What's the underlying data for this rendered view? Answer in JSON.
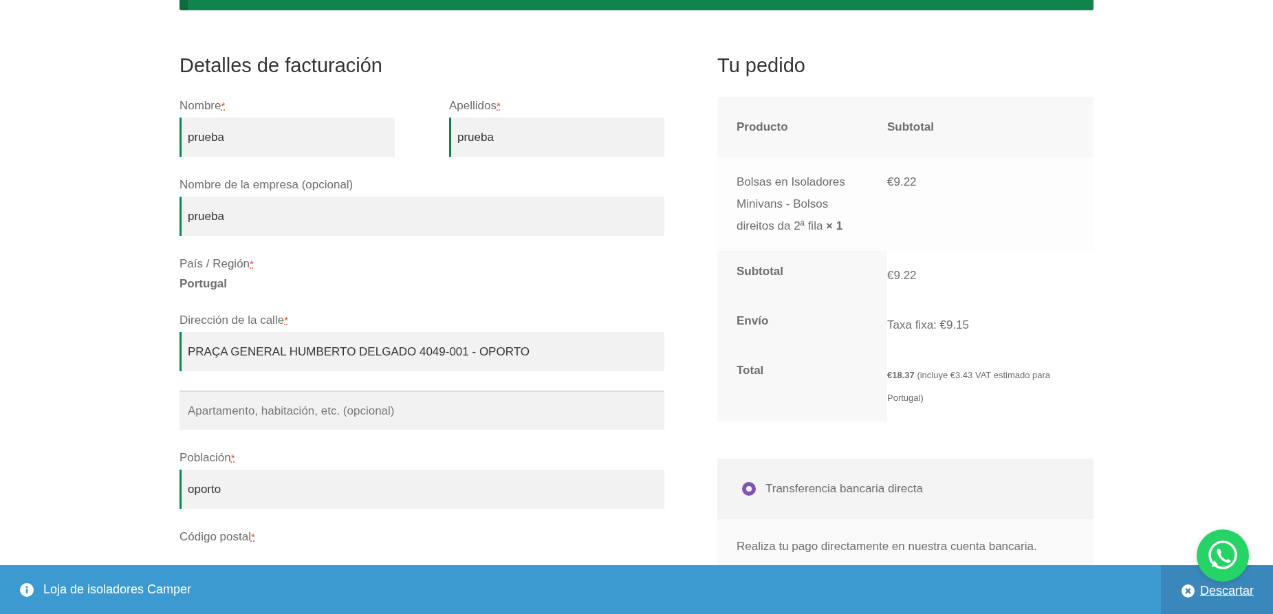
{
  "billing": {
    "title": "Detalles de facturación",
    "fields": [
      {
        "kind": "input",
        "half": true,
        "label": "Nombre",
        "required_mark": "*",
        "value": "prueba",
        "valid": true
      },
      {
        "kind": "input",
        "half": true,
        "label": "Apellidos",
        "required_mark": "*",
        "value": "prueba",
        "valid": true
      },
      {
        "kind": "input",
        "half": false,
        "label": "Nombre de la empresa (opcional)",
        "value": "prueba",
        "valid": true
      },
      {
        "kind": "static",
        "half": false,
        "label": "País / Región",
        "required_mark": "*",
        "value": "Portugal"
      },
      {
        "kind": "input",
        "half": false,
        "label": "Dirección de la calle",
        "required_mark": "*",
        "value": "PRAÇA GENERAL HUMBERTO DELGADO 4049-001 - OPORTO",
        "valid": true
      },
      {
        "kind": "input",
        "half": false,
        "placeholder": "Apartamento, habitación, etc. (opcional)",
        "valid": false
      },
      {
        "kind": "input",
        "half": false,
        "label": "Población",
        "required_mark": "*",
        "value": "oporto",
        "valid": true
      },
      {
        "kind": "label",
        "half": false,
        "label": "Código postal",
        "required_mark": "*"
      }
    ]
  },
  "order": {
    "title": "Tu pedido",
    "columns": [
      "Producto",
      "Subtotal"
    ],
    "items": [
      {
        "name": "Bolsas en Isoladores Minivans - Bolsos direitos da 2ª fila  **× 1**",
        "subtotal": "€9.22"
      }
    ],
    "totals": [
      {
        "kind": "line",
        "label": "Subtotal",
        "value": "€9.22"
      },
      {
        "kind": "line",
        "label": "Envío",
        "value": "Taxa fixa: €9.15"
      },
      {
        "kind": "grand",
        "label": "Total",
        "value": "**€18.37** (incluye €3.43 VAT estimado para Portugal)"
      }
    ]
  },
  "payment": {
    "methods": [
      {
        "label": "Transferencia bancaria directa",
        "selected": true
      }
    ],
    "description": "Realiza tu pago directamente en nuestra cuenta bancaria."
  },
  "notice": {
    "text": "Loja de isoladores Camper",
    "dismiss": "Descartar"
  }
}
